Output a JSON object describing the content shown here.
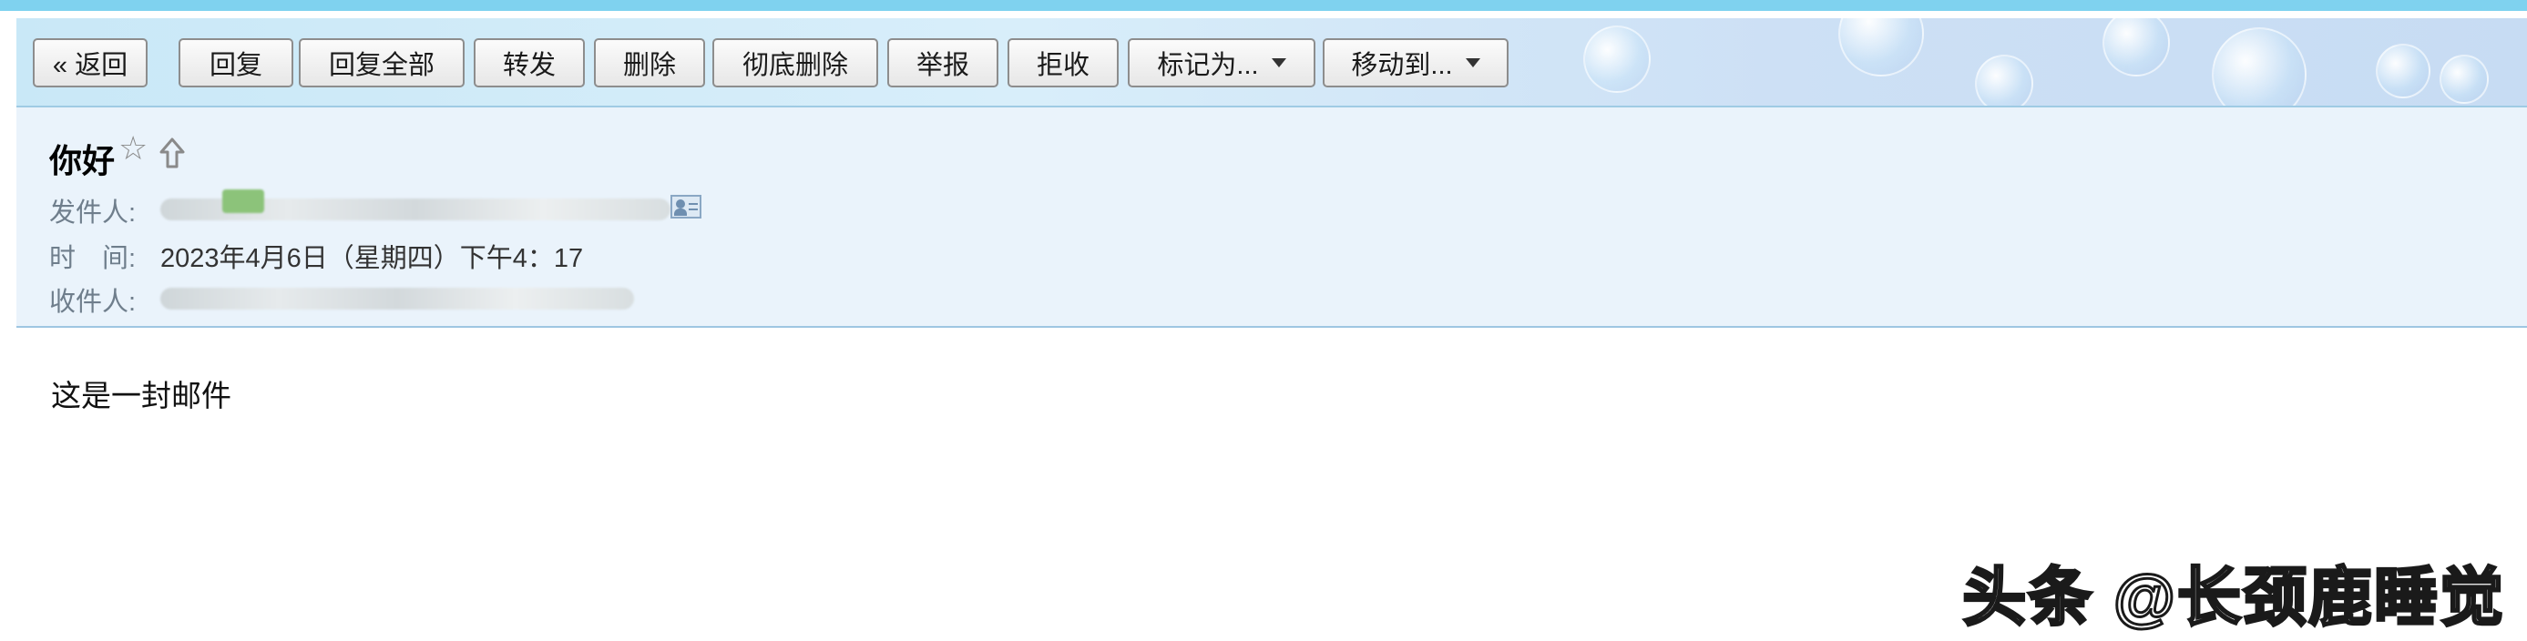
{
  "toolbar": {
    "buttons": [
      {
        "label": "« 返回"
      },
      {
        "label": "回复"
      },
      {
        "label": "回复全部"
      },
      {
        "label": "转发"
      },
      {
        "label": "删除"
      },
      {
        "label": "彻底删除"
      },
      {
        "label": "举报"
      },
      {
        "label": "拒收"
      },
      {
        "label": "标记为..."
      },
      {
        "label": "移动到..."
      }
    ]
  },
  "email": {
    "subject": "你好",
    "from_label": "发件人:",
    "time_label": "时　间:",
    "time_value": "2023年4月6日（星期四）下午4：17",
    "to_label": "收件人:",
    "body_text": "这是一封邮件"
  },
  "watermark": {
    "text": "头条 @长颈鹿睡觉"
  },
  "colors": {
    "top_stripe": "#7fd2ef",
    "header_bg": "#eaf3fb",
    "label_gray": "#6f7e8c"
  }
}
